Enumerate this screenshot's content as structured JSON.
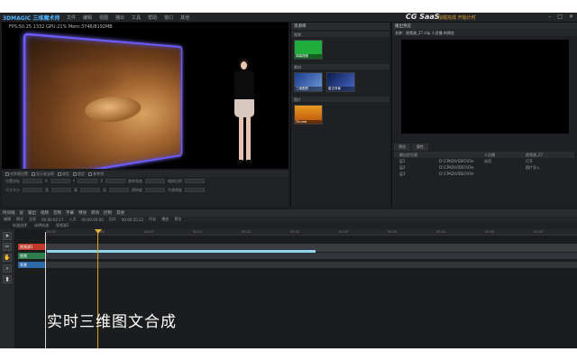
{
  "app": {
    "logo": "3DMAGIC 三维魔术师",
    "menu": [
      "文件",
      "编辑",
      "视图",
      "播出",
      "工具",
      "帮助",
      "窗口",
      "其他"
    ],
    "brand": "CG SaaS",
    "titlebar_info": "加载完成 开始计时"
  },
  "preview": {
    "stats": "FPS:50.25   1332   GPU:21% Mem:3746/8192MB"
  },
  "props": {
    "bar": [
      "对齐格设置",
      "显示安全框",
      "绑定",
      "锁定",
      "参考线"
    ],
    "row1": [
      "位置坐标",
      "X",
      "Y",
      "Z",
      "旋转角度",
      "缩放比例"
    ],
    "row2": [
      "尺寸大小",
      "宽",
      "高",
      "深",
      "透明度",
      "不透明度"
    ]
  },
  "assets": {
    "title": "资源库",
    "sections": [
      "视频",
      "素材",
      "图片"
    ],
    "items": [
      {
        "label": "绿幕视频"
      },
      {
        "label": "三维图表"
      },
      {
        "label": "星空背景"
      },
      {
        "label": "Thumb"
      }
    ]
  },
  "right_panel": {
    "title": "播出预览",
    "subtitle": "名称：视频源_27.clip 人员播 的预览",
    "tabs": [
      "预览",
      "属性"
    ],
    "tree": [
      {
        "c1": "输出信号源",
        "c2": "",
        "c3": "人员播",
        "c4": "视频源_27"
      },
      {
        "c1": "层1",
        "c2": "D:\\CPAD\\VIDEO\\File",
        "c3": "选项",
        "c4": "打开"
      },
      {
        "c1": "层2",
        "c2": "D:\\CPAD\\VIDEO\\File",
        "c3": "",
        "c4": "图片导入"
      },
      {
        "c1": "层3",
        "c2": "D:\\CPAD\\VIDEO\\File",
        "c3": "",
        "c4": ""
      }
    ]
  },
  "timeline": {
    "tabs": [
      "时间线",
      "层",
      "输出",
      "视频",
      "音频",
      "字幕",
      "特效",
      "转场",
      "控制",
      "其他"
    ],
    "bar": [
      "编辑",
      "模式",
      "全部",
      "00:00:02:17",
      "入点",
      "00:00:00:00",
      "出点",
      "00:00:55:22",
      "时长",
      "播放",
      "预览"
    ],
    "bar2": [
      "轨道选择",
      "",
      "选择轨道",
      "",
      "视频源2"
    ],
    "ruler": [
      "00:00",
      "00:05",
      "00:10",
      "00:15",
      "00:20",
      "00:25",
      "00:30",
      "00:35",
      "00:40",
      "00:45",
      "00:50"
    ],
    "tracks": [
      {
        "name": "视频源1"
      },
      {
        "name": "视频"
      },
      {
        "name": "背景"
      }
    ]
  },
  "caption": "实时三维图文合成"
}
